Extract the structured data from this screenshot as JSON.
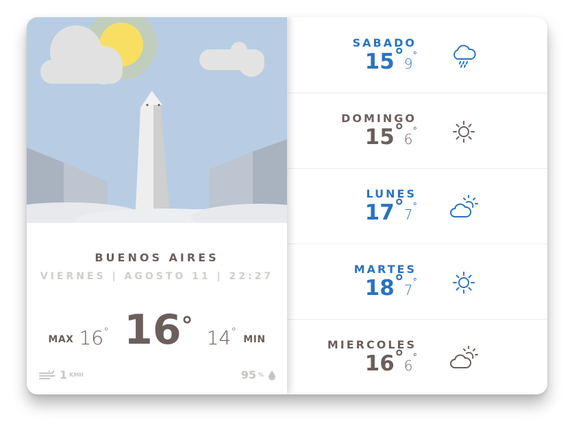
{
  "city": "BUENOS AIRES",
  "date_line": "VIERNES | AGOSTO 11 | 22:27",
  "current": {
    "max_label": "MAX",
    "max_value": "16",
    "temp": "16",
    "min_value": "14",
    "min_label": "MIN",
    "degree": "°"
  },
  "wind": {
    "value": "1",
    "unit": "KMH",
    "icon": "wind-icon"
  },
  "humidity": {
    "value": "95",
    "unit": "%",
    "icon": "droplet-icon"
  },
  "colors": {
    "accent": "#2a73c0",
    "text": "#6b5f5c",
    "muted": "#d1cdcb",
    "sky": "#b8cde4"
  },
  "forecast": [
    {
      "day": "SABADO",
      "high": "15",
      "low": "9",
      "icon": "rain-cloud-icon",
      "color": "#2a73c0"
    },
    {
      "day": "DOMINGO",
      "high": "15",
      "low": "6",
      "icon": "sun-icon",
      "color": "#6b5f5c"
    },
    {
      "day": "LUNES",
      "high": "17",
      "low": "7",
      "icon": "partly-cloudy-icon",
      "color": "#2a73c0"
    },
    {
      "day": "MARTES",
      "high": "18",
      "low": "7",
      "icon": "sun-icon",
      "color": "#2a73c0"
    },
    {
      "day": "MIERCOLES",
      "high": "16",
      "low": "6",
      "icon": "partly-cloudy-icon",
      "color": "#6b5f5c"
    }
  ]
}
